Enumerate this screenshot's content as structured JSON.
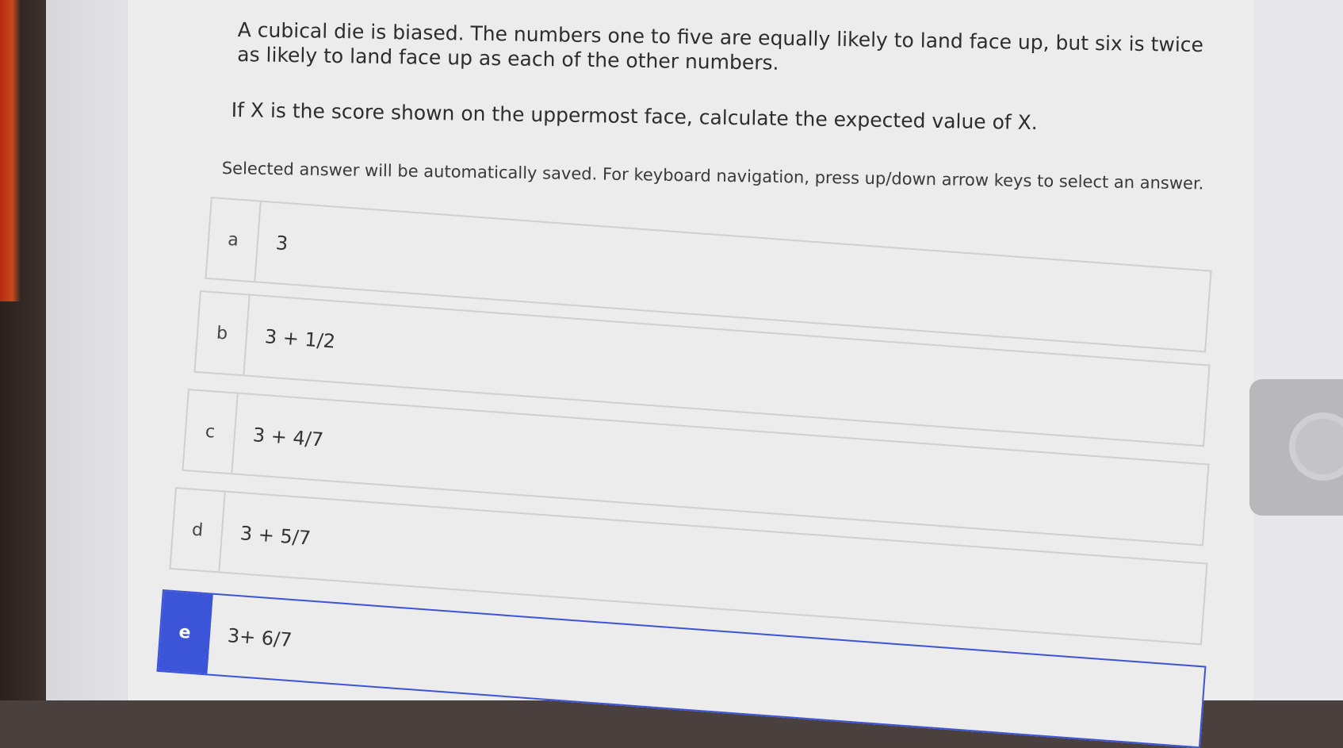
{
  "question": {
    "text": "A cubical die is biased. The numbers one to five are equally likely to land face up, but six is twice as likely to land face up as each of the other numbers.",
    "prompt": "If X is the score shown  on the uppermost face, calculate the expected value of X.",
    "instruction": "Selected answer will be automatically saved. For keyboard navigation, press up/down arrow keys to select an answer."
  },
  "options": [
    {
      "letter": "a",
      "value": "3"
    },
    {
      "letter": "b",
      "value": "3 + 1/2"
    },
    {
      "letter": "c",
      "value": "3 + 4/7"
    },
    {
      "letter": "d",
      "value": "3 + 5/7"
    },
    {
      "letter": "e",
      "value": "3+ 6/7"
    }
  ],
  "selected_option": "e",
  "colors": {
    "selected": "#3c54d8",
    "background": "#ececec"
  }
}
